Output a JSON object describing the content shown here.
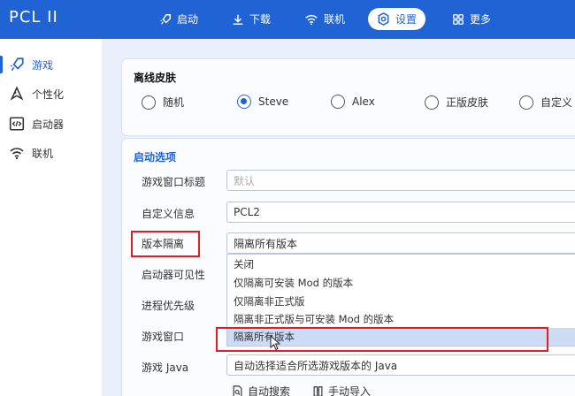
{
  "app": {
    "title": "PCL II"
  },
  "nav": [
    {
      "label": "启动",
      "icon": "rocket-icon"
    },
    {
      "label": "下载",
      "icon": "download-icon"
    },
    {
      "label": "联机",
      "icon": "wifi-icon"
    },
    {
      "label": "设置",
      "icon": "gear-icon",
      "active": true
    },
    {
      "label": "更多",
      "icon": "grid-icon"
    }
  ],
  "sidebar": [
    {
      "label": "游戏",
      "icon": "rocket-icon",
      "active": true
    },
    {
      "label": "个性化",
      "icon": "palette-icon"
    },
    {
      "label": "启动器",
      "icon": "code-window-icon"
    },
    {
      "label": "联机",
      "icon": "wifi-icon"
    }
  ],
  "skin": {
    "title": "离线皮肤",
    "options": [
      {
        "label": "随机",
        "checked": false
      },
      {
        "label": "Steve",
        "checked": true
      },
      {
        "label": "Alex",
        "checked": false
      },
      {
        "label": "正版皮肤",
        "checked": false
      },
      {
        "label": "自定义",
        "checked": false
      }
    ]
  },
  "launch": {
    "title": "启动选项",
    "rows": {
      "window_title": {
        "label": "游戏窗口标题",
        "placeholder": "默认"
      },
      "custom_info": {
        "label": "自定义信息",
        "value": "PCL2"
      },
      "isolation": {
        "label": "版本隔离",
        "value": "隔离所有版本"
      },
      "launcher_visibility": {
        "label": "启动器可见性"
      },
      "priority": {
        "label": "进程优先级"
      },
      "game_window": {
        "label": "游戏窗口"
      },
      "java": {
        "label": "游戏 Java",
        "value": "自动选择适合所选游戏版本的 Java"
      }
    },
    "isolation_options": [
      "关闭",
      "仅隔离可安装 Mod 的版本",
      "仅隔离非正式版",
      "隔离非正式版与可安装 Mod 的版本",
      "隔离所有版本"
    ],
    "selected_option_index": 4,
    "actions": [
      {
        "label": "自动搜索",
        "icon": "search-doc-icon"
      },
      {
        "label": "手动导入",
        "icon": "import-icon"
      }
    ]
  },
  "colors": {
    "accent": "#1f63d4",
    "highlight": "#e02020",
    "selected_bg": "#cddcf4"
  }
}
